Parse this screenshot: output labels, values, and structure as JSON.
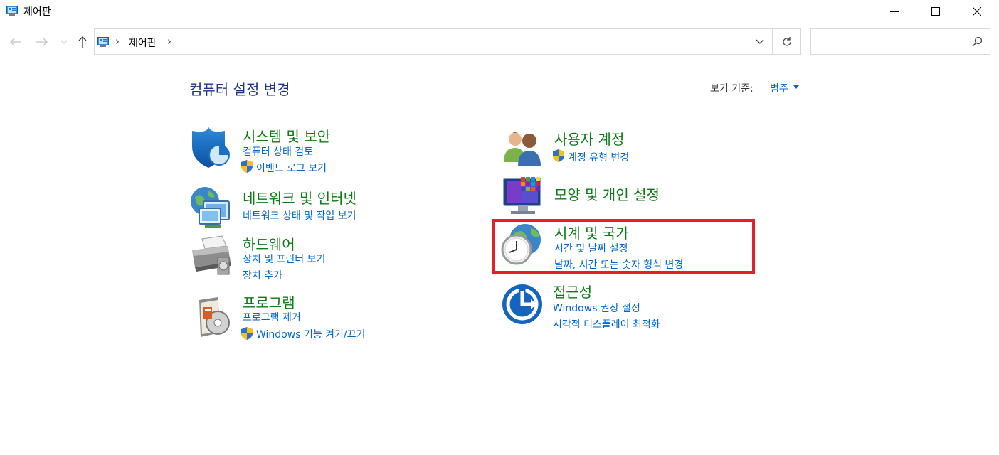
{
  "window": {
    "title": "제어판",
    "minimize_icon": "minimize-icon",
    "maximize_icon": "maximize-icon",
    "close_icon": "close-icon"
  },
  "nav": {
    "back_icon": "back-arrow-icon",
    "forward_icon": "forward-arrow-icon",
    "recent_icon": "chevron-down-icon",
    "up_icon": "up-arrow-icon"
  },
  "address": {
    "sep1": "›",
    "crumb": "제어판",
    "sep2": "›"
  },
  "search": {
    "placeholder": "",
    "icon": "search-icon"
  },
  "header": {
    "title": "컴퓨터 설정 변경",
    "view_by_label": "보기 기준:",
    "view_by_value": "범주"
  },
  "categories": [
    {
      "title": "시스템 및 보안",
      "icon": "system-security-shield-icon",
      "links": [
        {
          "label": "컴퓨터 상태 검토",
          "shield": false
        },
        {
          "label": "이벤트 로그 보기",
          "shield": true
        }
      ]
    },
    {
      "title": "네트워크 및 인터넷",
      "icon": "network-globe-icon",
      "links": [
        {
          "label": "네트워크 상태 및 작업 보기",
          "shield": false
        }
      ]
    },
    {
      "title": "하드웨어",
      "icon": "printer-icon",
      "links": [
        {
          "label": "장치 및 프린터 보기",
          "shield": false
        },
        {
          "label": "장치 추가",
          "shield": false
        }
      ]
    },
    {
      "title": "프로그램",
      "icon": "programs-disc-icon",
      "links": [
        {
          "label": "프로그램 제거",
          "shield": false
        },
        {
          "label": "Windows 기능 켜기/끄기",
          "shield": true
        }
      ]
    },
    {
      "title": "사용자 계정",
      "icon": "user-accounts-icon",
      "links": [
        {
          "label": "계정 유형 변경",
          "shield": true
        }
      ]
    },
    {
      "title": "모양 및 개인 설정",
      "icon": "appearance-monitor-icon",
      "links": []
    },
    {
      "title": "시계 및 국가",
      "icon": "clock-globe-icon",
      "highlighted": true,
      "links": [
        {
          "label": "시간 및 날짜 설정",
          "shield": false
        },
        {
          "label": "날짜, 시간 또는 숫자 형식 변경",
          "shield": false
        }
      ]
    },
    {
      "title": "접근성",
      "icon": "ease-of-access-icon",
      "links": [
        {
          "label": "Windows 권장 설정",
          "shield": false
        },
        {
          "label": "시각적 디스플레이 최적화",
          "shield": false
        }
      ]
    }
  ],
  "colors": {
    "category_title": "#0e7a17",
    "link": "#0066cc",
    "header_title": "#1e3287",
    "highlight_border": "#e3202a"
  }
}
